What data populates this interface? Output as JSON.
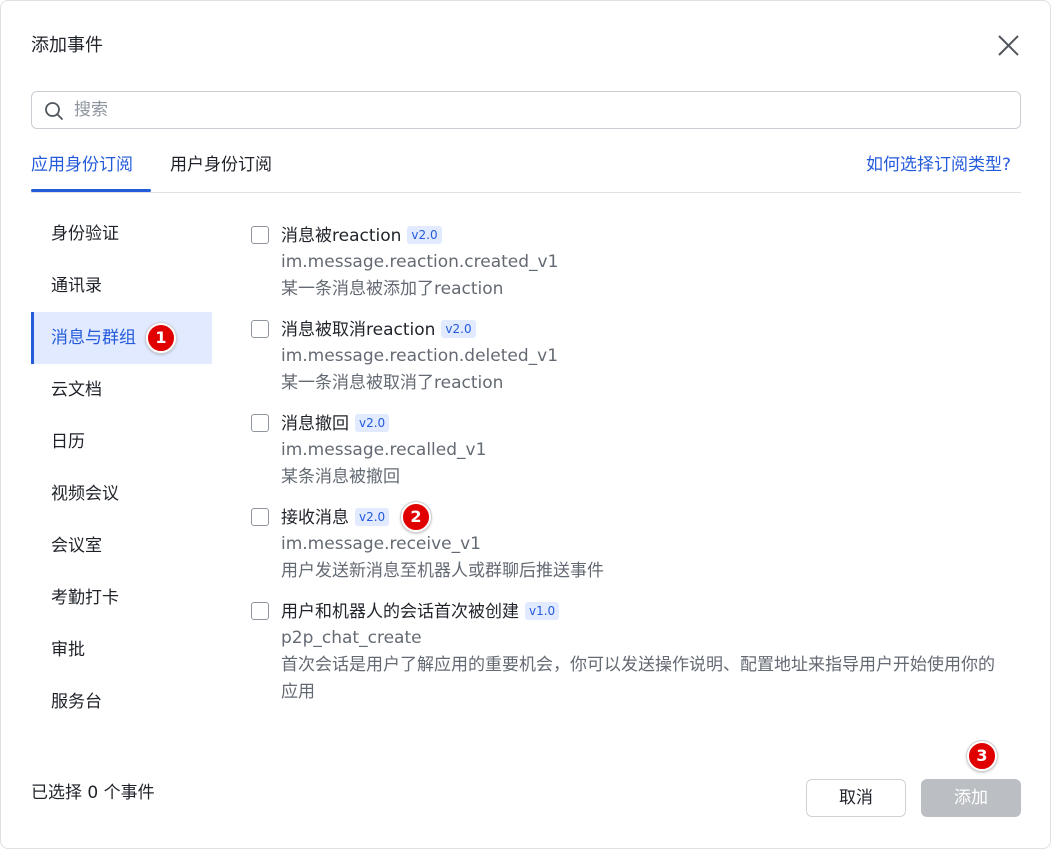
{
  "dialog": {
    "title": "添加事件"
  },
  "search": {
    "placeholder": "搜索",
    "value": ""
  },
  "tabs": [
    {
      "label": "应用身份订阅",
      "active": true
    },
    {
      "label": "用户身份订阅",
      "active": false
    }
  ],
  "help_link": "如何选择订阅类型?",
  "sidebar": {
    "items": [
      {
        "label": "身份验证",
        "active": false
      },
      {
        "label": "通讯录",
        "active": false
      },
      {
        "label": "消息与群组",
        "active": true
      },
      {
        "label": "云文档",
        "active": false
      },
      {
        "label": "日历",
        "active": false
      },
      {
        "label": "视频会议",
        "active": false
      },
      {
        "label": "会议室",
        "active": false
      },
      {
        "label": "考勤打卡",
        "active": false
      },
      {
        "label": "审批",
        "active": false
      },
      {
        "label": "服务台",
        "active": false
      }
    ]
  },
  "events": [
    {
      "title": "消息被reaction",
      "version": "v2.0",
      "key": "im.message.reaction.created_v1",
      "desc": "某一条消息被添加了reaction",
      "checked": false
    },
    {
      "title": "消息被取消reaction",
      "version": "v2.0",
      "key": "im.message.reaction.deleted_v1",
      "desc": "某一条消息被取消了reaction",
      "checked": false
    },
    {
      "title": "消息撤回",
      "version": "v2.0",
      "key": "im.message.recalled_v1",
      "desc": "某条消息被撤回",
      "checked": false
    },
    {
      "title": "接收消息",
      "version": "v2.0",
      "key": "im.message.receive_v1",
      "desc": "用户发送新消息至机器人或群聊后推送事件",
      "checked": false
    },
    {
      "title": "用户和机器人的会话首次被创建",
      "version": "v1.0",
      "key": "p2p_chat_create",
      "desc": "首次会话是用户了解应用的重要机会，你可以发送操作说明、配置地址来指导用户开始使用你的应用",
      "checked": false
    }
  ],
  "footer": {
    "selected_count": "已选择 0 个事件",
    "cancel_label": "取消",
    "add_label": "添加"
  },
  "markers": [
    "1",
    "2",
    "3"
  ],
  "colors": {
    "accent": "#245bdb",
    "active_bg": "#e1eaff",
    "disabled_button": "#bbbfc4",
    "marker": "#e00000"
  }
}
